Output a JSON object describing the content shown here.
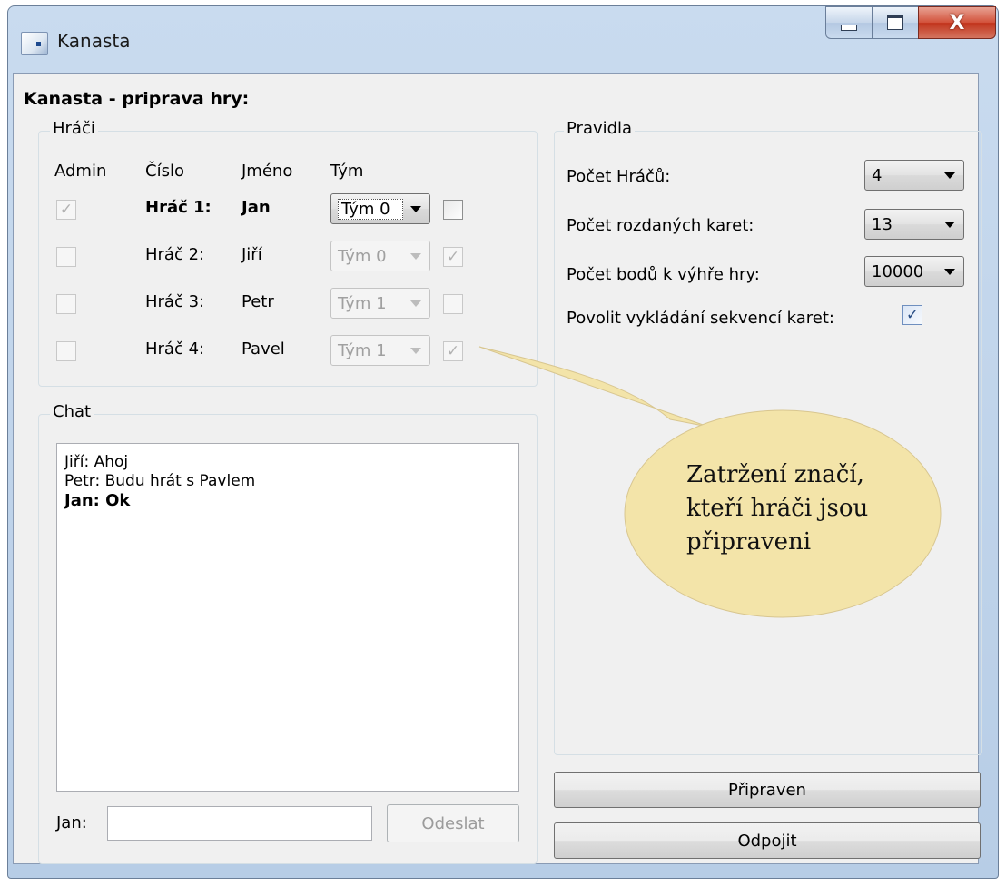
{
  "window": {
    "title": "Kanasta",
    "controls": {
      "minimize": "minimize",
      "maximize": "maximize",
      "close": "X"
    }
  },
  "heading": "Kanasta - priprava hry:",
  "players": {
    "group_label": "Hráči",
    "headers": {
      "admin": "Admin",
      "number": "Číslo",
      "name": "Jméno",
      "team": "Tým"
    },
    "rows": [
      {
        "admin": true,
        "number": "Hráč 1:",
        "name": "Jan",
        "team": "Tým 0",
        "ready": false,
        "current": true
      },
      {
        "admin": false,
        "number": "Hráč 2:",
        "name": "Jiří",
        "team": "Tým 0",
        "ready": true,
        "current": false
      },
      {
        "admin": false,
        "number": "Hráč 3:",
        "name": "Petr",
        "team": "Tým 1",
        "ready": false,
        "current": false
      },
      {
        "admin": false,
        "number": "Hráč 4:",
        "name": "Pavel",
        "team": "Tým 1",
        "ready": true,
        "current": false
      }
    ]
  },
  "chat": {
    "group_label": "Chat",
    "messages": [
      {
        "text": "Jiří: Ahoj",
        "bold": false
      },
      {
        "text": "Petr: Budu hrát s Pavlem",
        "bold": false
      },
      {
        "text": "Jan: Ok",
        "bold": true
      }
    ],
    "input_label": "Jan:",
    "input_value": "",
    "send_label": "Odeslat"
  },
  "rules": {
    "group_label": "Pravidla",
    "player_count_label": "Počet Hráčů:",
    "player_count": "4",
    "cards_dealt_label": "Počet rozdaných karet:",
    "cards_dealt": "13",
    "points_to_win_label": "Počet bodů k výhře hry:",
    "points_to_win": "10000",
    "sequences_label": "Povolit vykládání sekvencí karet:",
    "sequences_enabled": true
  },
  "buttons": {
    "ready": "Připraven",
    "disconnect": "Odpojit"
  },
  "callout": {
    "lines": [
      "Zatržení značí,",
      "kteří hráči jsou",
      "připraveni"
    ]
  }
}
